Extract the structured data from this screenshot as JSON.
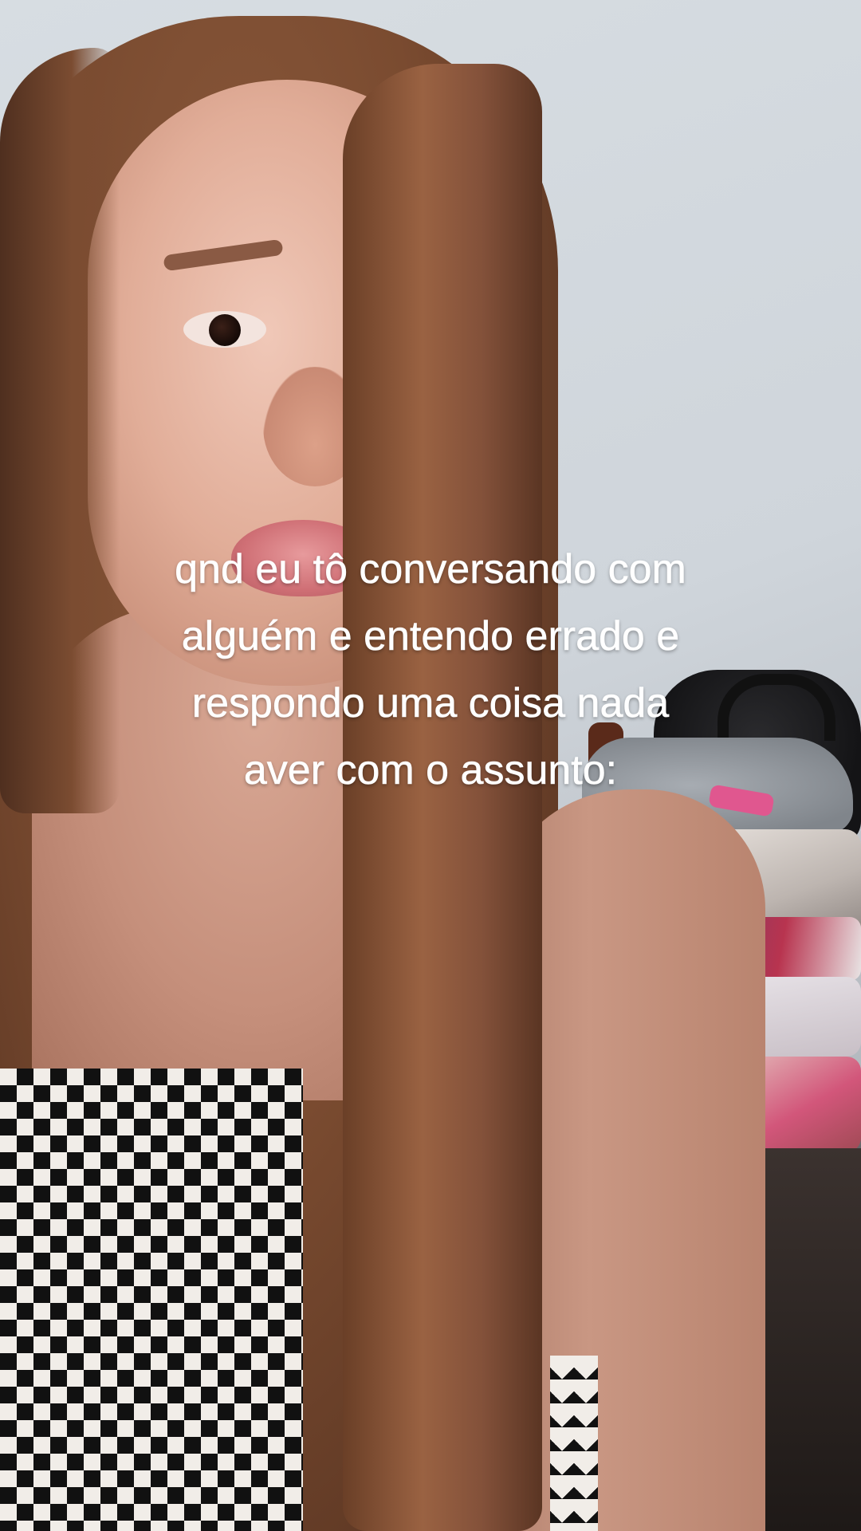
{
  "caption": {
    "lines": [
      "qnd eu tô conversando com",
      "alguém e entendo errado e",
      "respondo uma coisa nada",
      "aver com o assunto:"
    ]
  }
}
